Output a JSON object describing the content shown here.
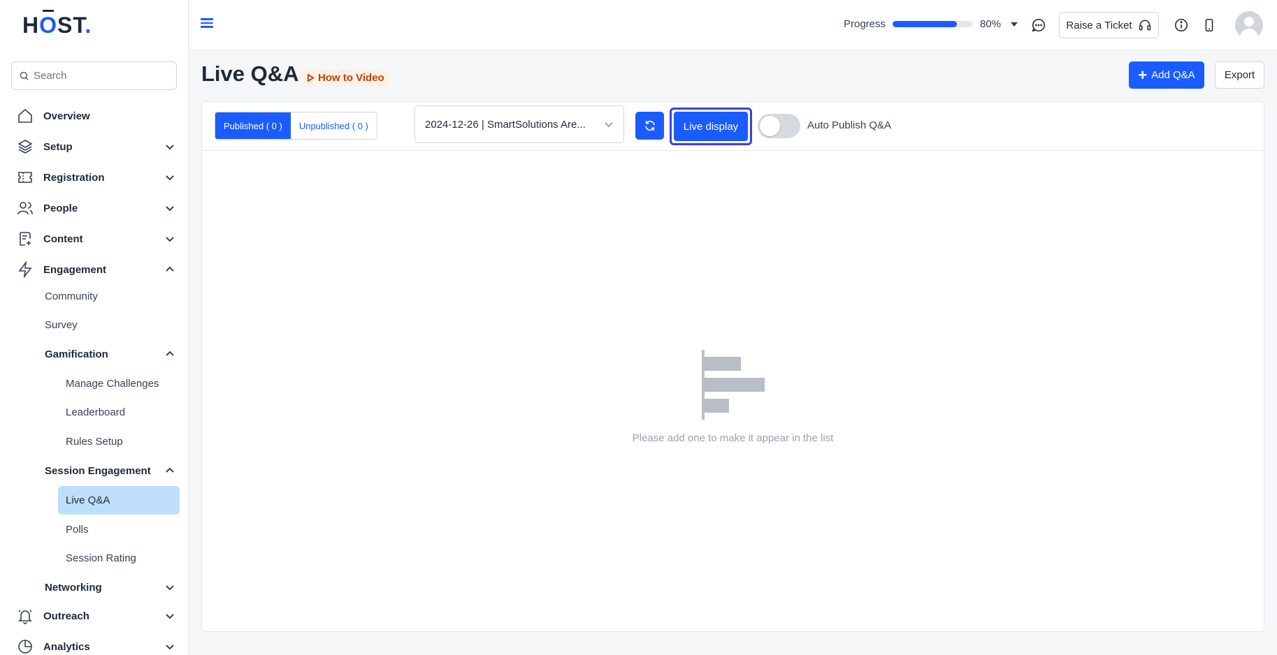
{
  "brand": {
    "logo_h": "H",
    "logo_o": "O",
    "logo_st": "ST",
    "logo_dot": "."
  },
  "sidebar": {
    "search_placeholder": "Search",
    "items": [
      {
        "label": "Overview",
        "icon": "home-icon"
      },
      {
        "label": "Setup",
        "icon": "layers-icon"
      },
      {
        "label": "Registration",
        "icon": "ticket-icon"
      },
      {
        "label": "People",
        "icon": "people-icon"
      },
      {
        "label": "Content",
        "icon": "content-icon"
      },
      {
        "label": "Engagement",
        "icon": "lightning-icon",
        "expanded": true
      },
      {
        "label": "Outreach",
        "icon": "bell-icon"
      },
      {
        "label": "Analytics",
        "icon": "pie-chart-icon"
      }
    ],
    "engagement_sub": {
      "community": "Community",
      "survey": "Survey",
      "gamification": "Gamification",
      "manage_challenges": "Manage Challenges",
      "leaderboard": "Leaderboard",
      "rules_setup": "Rules Setup",
      "session_engagement": "Session Engagement",
      "live_qa": "Live Q&A",
      "polls": "Polls",
      "session_rating": "Session Rating",
      "networking": "Networking"
    }
  },
  "header": {
    "progress_label": "Progress",
    "progress_value": 0.8,
    "progress_text": "80%",
    "raise_ticket": "Raise a Ticket"
  },
  "page": {
    "title": "Live Q&A",
    "how_to": "How to Video",
    "add_button": "Add Q&A",
    "export_button": "Export"
  },
  "toolbar": {
    "tab_published": "Published ( 0 )",
    "tab_unpublished": "Unpublished ( 0 )",
    "session_select": "2024-12-26 | SmartSolutions Are...",
    "live_display": "Live display",
    "auto_publish": "Auto Publish Q&A",
    "auto_publish_on": false
  },
  "empty_state": {
    "message": "Please add one to make it appear in the list"
  },
  "colors": {
    "accent": "#1a5cff",
    "active_nav": "#bfdefb",
    "how_to": "#c2410c"
  }
}
